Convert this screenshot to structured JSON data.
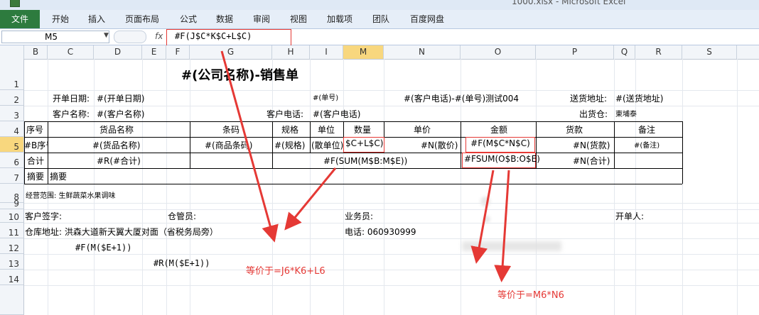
{
  "window": {
    "title": "1000.xlsx - Microsoft Excel"
  },
  "ribbon": {
    "file_label": "文件",
    "tabs": [
      "开始",
      "插入",
      "页面布局",
      "公式",
      "数据",
      "审阅",
      "视图",
      "加载项",
      "团队",
      "百度网盘"
    ]
  },
  "formula_bar": {
    "name_box": "M5",
    "fx": "fx",
    "formula": "#F(J$C*K$C+L$C)"
  },
  "columns": [
    "B",
    "C",
    "D",
    "E",
    "F",
    "G",
    "H",
    "I",
    "M",
    "N",
    "O",
    "P",
    "Q",
    "R",
    "S"
  ],
  "selected_column": "M",
  "rows": [
    "1",
    "2",
    "3",
    "4",
    "5",
    "6",
    "7",
    "8",
    "9",
    "10",
    "11",
    "12",
    "13",
    "14"
  ],
  "selected_row": "5",
  "sheet": {
    "title": "#(公司名称)-销售单",
    "r2": {
      "open_date_label": "开单日期:",
      "open_date_value": "#(开单日期)",
      "order_no": "#(单号)",
      "customer_phone_order": "#(客户电话)-#(单号)测试004",
      "delivery_addr_label": "送货地址:",
      "delivery_addr_value": "#(送货地址)"
    },
    "r3": {
      "customer_name_label": "客户名称:",
      "customer_name_value": "#(客户名称)",
      "customer_phone_label": "客户电话:",
      "customer_phone_value": "#(客户电话)",
      "warehouse_label": "出货仓:",
      "warehouse_value": "東埔泰"
    },
    "header": {
      "seq": "序号",
      "goods": "货品名称",
      "barcode": "条码",
      "spec": "规格",
      "unit": "单位",
      "qty": "数量",
      "price": "单价",
      "amount": "金额",
      "payment": "货款",
      "remark": "备注"
    },
    "r5": {
      "seq": "#B序号",
      "goods": "#(货品名称)",
      "barcode": "#(商品条码)",
      "spec": "#(规格)",
      "unit": "(散单位)",
      "qty": "$C+L$C)",
      "price": "#N(散价)",
      "amount": "#F(M$C*N$C)",
      "payment": "#N(货款)",
      "remark": "#(备注)"
    },
    "r6": {
      "total_label": "合计",
      "total_goods": "#R(#合计)",
      "sum_qty": "#F(SUM(M$B:M$E))",
      "sum_amount": "#FSUM(O$B:O$E)",
      "sum_payment": "#N(合计)"
    },
    "r7": {
      "summary_label": "摘要",
      "summary_value": "摘要"
    },
    "r8": {
      "scope": "经营范围: 生鲜蔬菜水果调味"
    },
    "r10": {
      "customer_sign": "客户签字:",
      "keeper": "仓管员:",
      "salesman": "业务员:",
      "drawer": "开单人:"
    },
    "r11": {
      "warehouse_addr": "仓库地址: 洪森大道新天翼大厦对面（省税务局旁）",
      "phone": "电话: 060930999"
    },
    "r12": {
      "formula": "#F(M($E+1))"
    },
    "r13": {
      "formula": "#R(M($E+1))"
    }
  },
  "annotations": {
    "left": "等价于=J6*K6+L6",
    "right": "等价于=M6*N6"
  }
}
